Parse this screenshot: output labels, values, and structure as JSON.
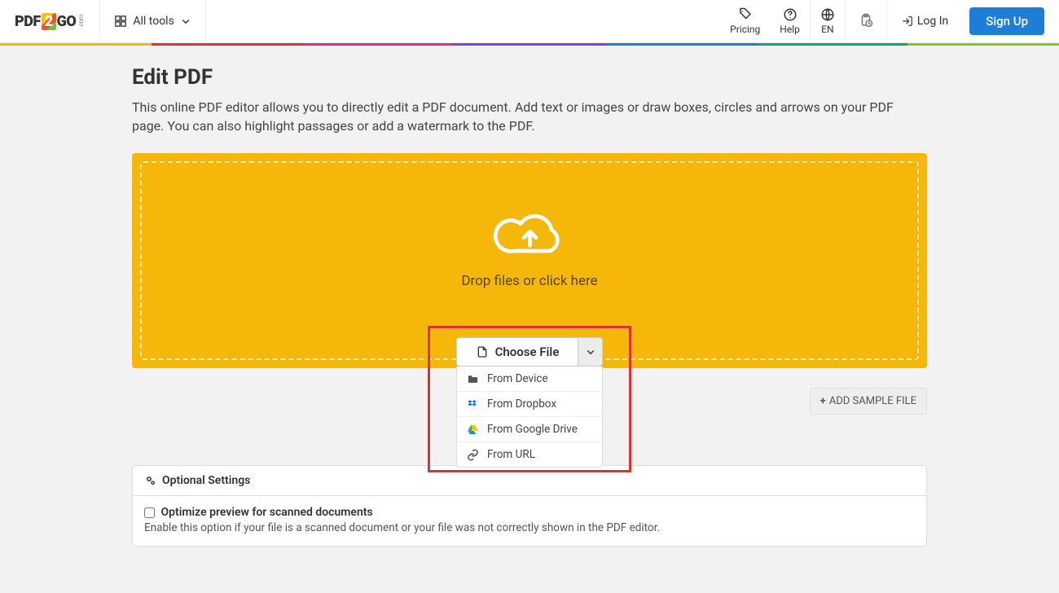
{
  "header": {
    "logo_left": "PDF",
    "logo_mid": "2",
    "logo_right": "GO",
    "logo_small": ".com",
    "alltools": "All tools",
    "pricing": "Pricing",
    "help": "Help",
    "lang": "EN",
    "login": "Log In",
    "signup": "Sign Up"
  },
  "page": {
    "title": "Edit PDF",
    "subtitle": "This online PDF editor allows you to directly edit a PDF document. Add text or images or draw boxes, circles and arrows on your PDF page. You can also highlight passages or add a watermark to the PDF.",
    "drop_label": "Drop files or click here",
    "choose_label": "Choose File",
    "sources": {
      "device": "From Device",
      "dropbox": "From Dropbox",
      "gdrive": "From Google Drive",
      "url": "From URL"
    },
    "sample_btn": "ADD SAMPLE FILE"
  },
  "optional": {
    "heading": "Optional Settings",
    "checkbox_label": "Optimize preview for scanned documents",
    "checkbox_desc": "Enable this option if your file is a scanned document or your file was not correctly shown in the PDF editor."
  },
  "colorbar": [
    "#f4b70a",
    "#e03131",
    "#e03176",
    "#7048e8",
    "#1c7ed6",
    "#0ca678",
    "#82c91e"
  ]
}
